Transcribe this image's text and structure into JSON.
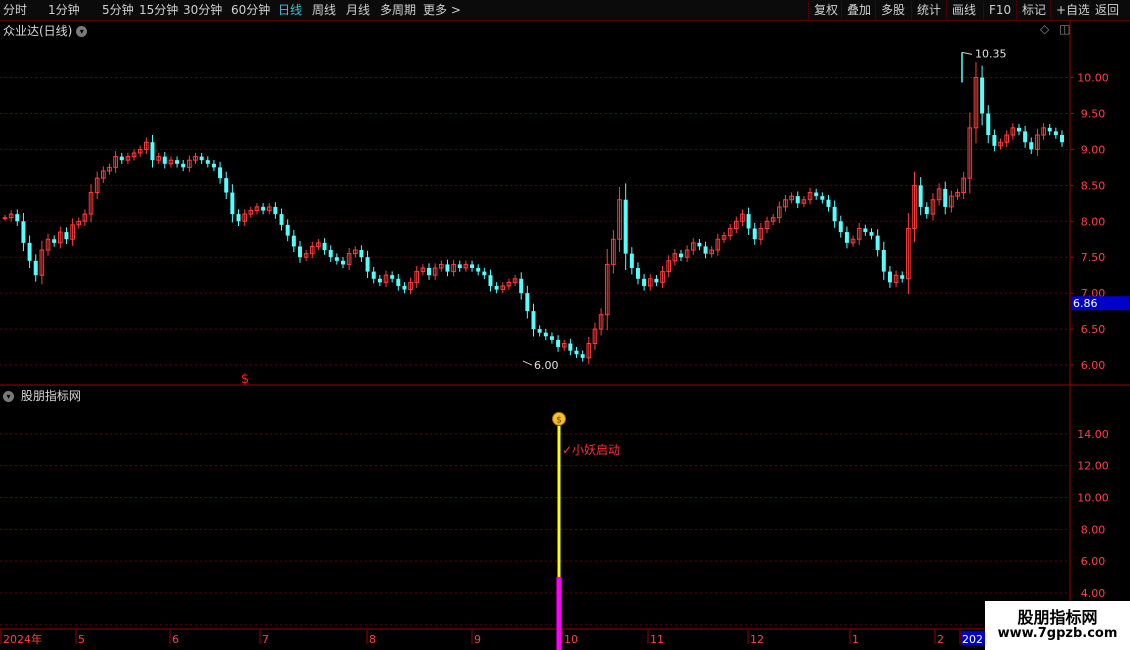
{
  "toolbar": {
    "periods": [
      "分时",
      "1分钟",
      "5分钟",
      "15分钟",
      "30分钟",
      "60分钟",
      "日线",
      "周线",
      "月线",
      "多周期",
      "更多 >"
    ],
    "active_period": "日线",
    "actions": [
      "复权",
      "叠加",
      "多股",
      "统计",
      "画线",
      "F10",
      "标记",
      "+自选",
      "返回"
    ]
  },
  "main_panel": {
    "title": "众业达(日线)",
    "current_price_tag": "6.86",
    "high_label": "10.35",
    "low_label": "6.00",
    "signal_marker": "$"
  },
  "sub_panel": {
    "title": "股朋指标网",
    "signal_text": "✓小妖启动",
    "signal_icon": "money-bag-icon"
  },
  "time_axis": [
    "2024年",
    "5",
    "6",
    "7",
    "8",
    "9",
    "10",
    "11",
    "12",
    "1",
    "2",
    "202"
  ],
  "watermark": {
    "line1": "股朋指标网",
    "line2": "www.7gpzb.com"
  },
  "colors": {
    "up": "#ff3c3c",
    "down": "#54ffff",
    "grid": "#6a0000",
    "yellow_bar": "#ffff00",
    "magenta_bar": "#ff00ff",
    "axis_text": "#ff4040",
    "current_tag_bg": "#0000c8"
  },
  "chart_data": [
    {
      "type": "candlestick",
      "title": "众业达(日线)",
      "y_ticks": [
        6.0,
        6.5,
        7.0,
        7.5,
        8.0,
        8.5,
        9.0,
        9.5,
        10.0
      ],
      "ylim": [
        5.75,
        10.55
      ],
      "x_ticks": [
        "2024年",
        "5",
        "6",
        "7",
        "8",
        "9",
        "10",
        "11",
        "12",
        "1",
        "2",
        "202"
      ],
      "annotations": [
        {
          "text": "10.35",
          "value": 10.35
        },
        {
          "text": "6.00",
          "value": 6.0
        },
        {
          "text": "6.86",
          "value": 6.86
        }
      ],
      "close_series": [
        8.05,
        8.1,
        8.0,
        7.7,
        7.45,
        7.25,
        7.6,
        7.75,
        7.7,
        7.85,
        7.75,
        7.95,
        8.0,
        8.1,
        8.4,
        8.6,
        8.7,
        8.75,
        8.9,
        8.85,
        8.9,
        8.95,
        9.0,
        9.1,
        8.85,
        8.9,
        8.8,
        8.85,
        8.8,
        8.75,
        8.85,
        8.9,
        8.85,
        8.8,
        8.75,
        8.6,
        8.4,
        8.1,
        8.0,
        8.1,
        8.15,
        8.2,
        8.15,
        8.2,
        8.1,
        7.95,
        7.8,
        7.65,
        7.5,
        7.55,
        7.65,
        7.7,
        7.6,
        7.5,
        7.45,
        7.4,
        7.55,
        7.6,
        7.5,
        7.3,
        7.2,
        7.15,
        7.25,
        7.2,
        7.1,
        7.05,
        7.15,
        7.3,
        7.35,
        7.25,
        7.35,
        7.4,
        7.3,
        7.4,
        7.35,
        7.4,
        7.35,
        7.3,
        7.25,
        7.1,
        7.05,
        7.1,
        7.15,
        7.2,
        7.0,
        6.75,
        6.5,
        6.45,
        6.4,
        6.35,
        6.25,
        6.3,
        6.2,
        6.15,
        6.1,
        6.3,
        6.5,
        6.7,
        7.4,
        7.75,
        8.3,
        7.55,
        7.35,
        7.2,
        7.1,
        7.2,
        7.15,
        7.3,
        7.45,
        7.55,
        7.5,
        7.6,
        7.7,
        7.65,
        7.55,
        7.6,
        7.75,
        7.8,
        7.9,
        8.0,
        8.1,
        7.9,
        7.75,
        7.9,
        8.0,
        8.05,
        8.2,
        8.3,
        8.35,
        8.25,
        8.3,
        8.4,
        8.35,
        8.3,
        8.2,
        8.0,
        7.85,
        7.7,
        7.75,
        7.9,
        7.85,
        7.8,
        7.6,
        7.3,
        7.15,
        7.25,
        7.2,
        7.9,
        8.5,
        8.2,
        8.1,
        8.3,
        8.45,
        8.2,
        8.35,
        8.4,
        8.6,
        9.3,
        10.0,
        9.5,
        9.2,
        9.05,
        9.1,
        9.2,
        9.3,
        9.25,
        9.1,
        9.0,
        9.2,
        9.3,
        9.25,
        9.2,
        9.1
      ]
    },
    {
      "type": "bar",
      "title": "股朋指标网",
      "y_ticks": [
        2.0,
        4.0,
        6.0,
        8.0,
        10.0,
        12.0,
        14.0
      ],
      "ylim": [
        1.8,
        16.0
      ],
      "signal": {
        "label": "✓小妖启动",
        "top": 14.5,
        "split": 5.0,
        "base": 0
      }
    }
  ]
}
